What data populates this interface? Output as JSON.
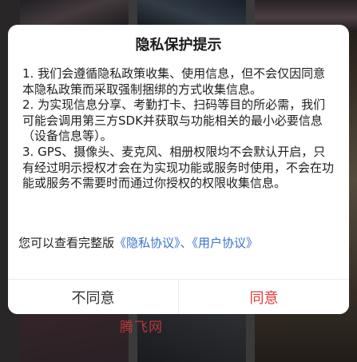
{
  "dialog": {
    "title": "隐私保护提示",
    "paragraphs": [
      "1. 我们会遵循隐私政策收集、使用信息，但不会仅因同意本隐私政策而采取强制捆绑的方式收集信息。",
      "2. 为实现信息分享、考勤打卡、扫码等目的所必需，我们可能会调用第三方SDK并获取与功能相关的最小必要信息（设备信息等）。",
      "3. GPS、摄像头、麦克风、相册权限均不会默认开启，只有经过明示授权才会在为实现功能或服务时使用，不会在功能或服务不需要时而通过你授权的权限收集信息。"
    ],
    "agreements": {
      "prefix": "您可以查看完整版",
      "privacy_link": "《隐私协议》",
      "separator": "、",
      "user_link": "《用户协议》"
    },
    "buttons": {
      "disagree": "不同意",
      "agree": "同意"
    }
  },
  "watermark": "腾飞网",
  "colors": {
    "accent_red": "#e23a3a",
    "link_blue": "#3a73c7"
  }
}
